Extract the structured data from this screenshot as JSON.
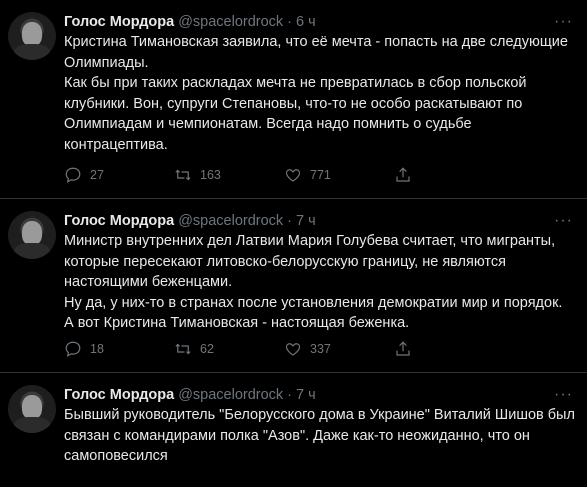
{
  "tweets": [
    {
      "name": "Голос Мордора",
      "handle": "@spacelordrock",
      "time": "6 ч",
      "lines": [
        "Кристина Тимановская заявила, что её мечта - попасть на две следующие Олимпиады.",
        "Как бы при таких раскладах мечта не превратилась в сбор польской клубники. Вон, супруги Степановы, что-то не особо раскатывают по Олимпиадам и чемпионатам. Всегда надо помнить о судьбе контрацептива."
      ],
      "replies": "27",
      "retweets": "163",
      "likes": "771"
    },
    {
      "name": "Голос Мордора",
      "handle": "@spacelordrock",
      "time": "7 ч",
      "lines": [
        "Министр внутренних дел Латвии Мария Голубева считает, что мигранты, которые пересекают литовско-белорусскую границу, не являются настоящими беженцами.",
        "Ну да, у них-то в странах после установления демократии мир и порядок. А вот Кристина Тимановская - настоящая беженка."
      ],
      "replies": "18",
      "retweets": "62",
      "likes": "337"
    },
    {
      "name": "Голос Мордора",
      "handle": "@spacelordrock",
      "time": "7 ч",
      "lines": [
        "Бывший руководитель \"Белорусского дома в Украине\" Виталий Шишов был связан с командирами полка \"Азов\". Даже как-то неожиданно, что он самоповесился"
      ]
    }
  ],
  "colors": {
    "background": "#000000",
    "text": "#e7e9ea",
    "muted": "#6e767d",
    "divider": "#2f3336"
  }
}
